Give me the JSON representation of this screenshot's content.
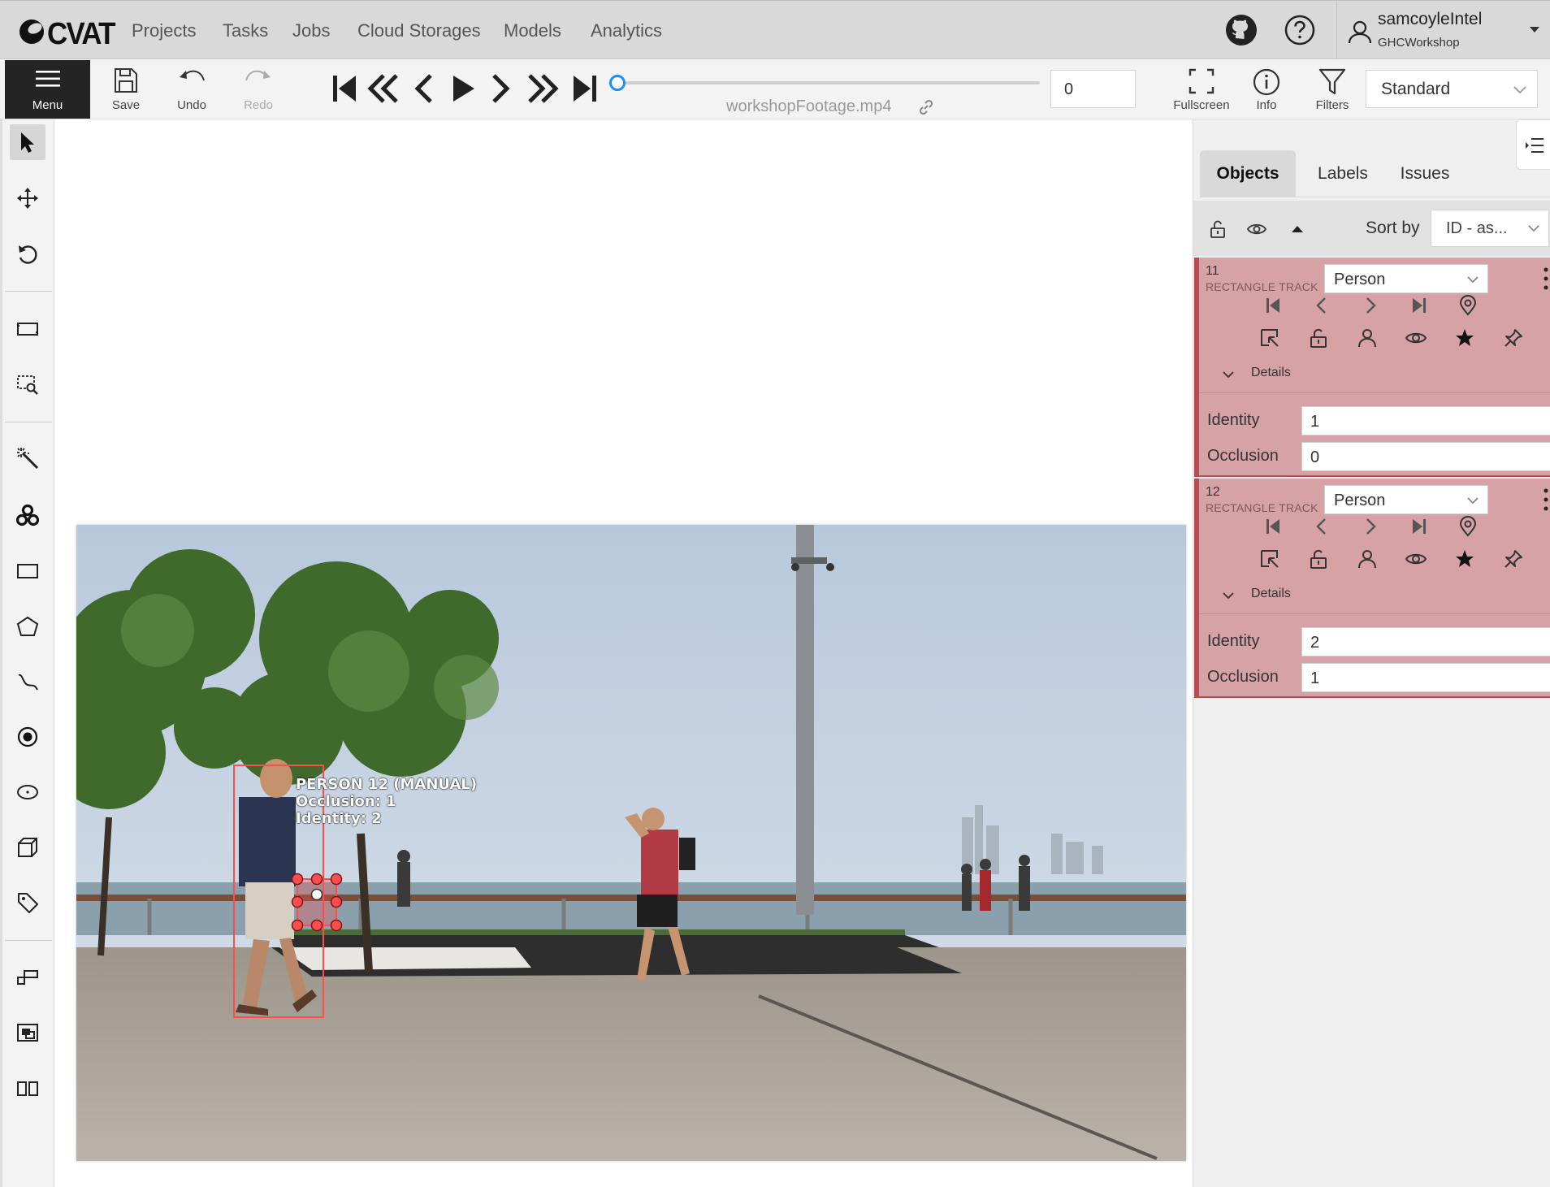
{
  "app": {
    "logo_text": "CVAT"
  },
  "nav": {
    "links": [
      "Projects",
      "Tasks",
      "Jobs",
      "Cloud Storages",
      "Models",
      "Analytics"
    ],
    "user": {
      "name": "samcoyleIntel",
      "organization": "GHCWorkshop"
    }
  },
  "toolbar": {
    "menu_label": "Menu",
    "save_label": "Save",
    "undo_label": "Undo",
    "redo_label": "Redo",
    "frame_number": "0",
    "frame_progress": 0,
    "filename": "workshopFootage.mp4",
    "fullscreen_label": "Fullscreen",
    "info_label": "Info",
    "filters_label": "Filters",
    "workspace": "Standard"
  },
  "left_tools": [
    "cursor-icon",
    "move-icon",
    "rotate-icon",
    "fit-image-icon",
    "zoom-region-icon",
    "magic-wand-icon",
    "opencv-icon",
    "rectangle-icon",
    "polygon-icon",
    "polyline-icon",
    "points-icon",
    "ellipse-icon",
    "cuboid-icon",
    "tag-icon",
    "merge-icon",
    "group-icon",
    "split-icon"
  ],
  "canvas": {
    "shape_label": {
      "title": "PERSON 12 (MANUAL)",
      "line1": "Occlusion: 1",
      "line2": "Identity: 2"
    },
    "shape_color": "#ff4d4d"
  },
  "sidebar": {
    "tabs": [
      "Objects",
      "Labels",
      "Issues"
    ],
    "active_tab": "Objects",
    "sort_label": "Sort by",
    "sort_value": "ID - as...",
    "objects": [
      {
        "id": "11",
        "type": "RECTANGLE TRACK",
        "label": "Person",
        "details_label": "Details",
        "attributes": [
          {
            "name": "Identity",
            "value": "1"
          },
          {
            "name": "Occlusion",
            "value": "0"
          }
        ]
      },
      {
        "id": "12",
        "type": "RECTANGLE TRACK",
        "label": "Person",
        "details_label": "Details",
        "attributes": [
          {
            "name": "Identity",
            "value": "2"
          },
          {
            "name": "Occlusion",
            "value": "1"
          }
        ]
      }
    ],
    "object_color": "#d7a2a5",
    "object_border_color": "#b94b52"
  }
}
